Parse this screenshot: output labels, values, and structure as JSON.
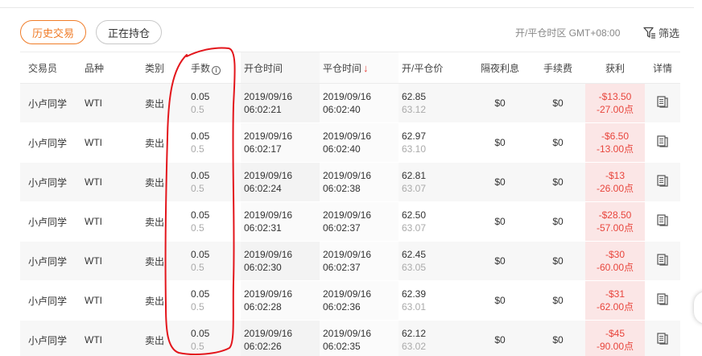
{
  "tabs": [
    {
      "label": "历史交易",
      "active": true
    },
    {
      "label": "正在持仓",
      "active": false
    }
  ],
  "timezone_label": "开/平仓时区 GMT+08:00",
  "filter_label": "筛选",
  "columns": {
    "trader": "交易员",
    "symbol": "品种",
    "type": "类别",
    "lots": "手数",
    "open_time": "开仓时间",
    "close_time": "平仓时间",
    "price": "开/平仓价",
    "swap": "隔夜利息",
    "fee": "手续费",
    "profit": "获利",
    "detail": "详情"
  },
  "sort_indicator": "↓",
  "rows": [
    {
      "trader": "小卢同学",
      "symbol": "WTI",
      "type": "卖出",
      "lots": "0.05",
      "lots_sub": "0.5",
      "open_date": "2019/09/16",
      "open_time": "06:02:21",
      "close_date": "2019/09/16",
      "close_time": "06:02:40",
      "open_price": "62.85",
      "close_price": "63.12",
      "swap": "$0",
      "fee": "$0",
      "profit": "-$13.50",
      "points": "-27.00点"
    },
    {
      "trader": "小卢同学",
      "symbol": "WTI",
      "type": "卖出",
      "lots": "0.05",
      "lots_sub": "0.5",
      "open_date": "2019/09/16",
      "open_time": "06:02:17",
      "close_date": "2019/09/16",
      "close_time": "06:02:40",
      "open_price": "62.97",
      "close_price": "63.10",
      "swap": "$0",
      "fee": "$0",
      "profit": "-$6.50",
      "points": "-13.00点"
    },
    {
      "trader": "小卢同学",
      "symbol": "WTI",
      "type": "卖出",
      "lots": "0.05",
      "lots_sub": "0.5",
      "open_date": "2019/09/16",
      "open_time": "06:02:24",
      "close_date": "2019/09/16",
      "close_time": "06:02:38",
      "open_price": "62.81",
      "close_price": "63.07",
      "swap": "$0",
      "fee": "$0",
      "profit": "-$13",
      "points": "-26.00点"
    },
    {
      "trader": "小卢同学",
      "symbol": "WTI",
      "type": "卖出",
      "lots": "0.05",
      "lots_sub": "0.5",
      "open_date": "2019/09/16",
      "open_time": "06:02:31",
      "close_date": "2019/09/16",
      "close_time": "06:02:37",
      "open_price": "62.50",
      "close_price": "63.07",
      "swap": "$0",
      "fee": "$0",
      "profit": "-$28.50",
      "points": "-57.00点"
    },
    {
      "trader": "小卢同学",
      "symbol": "WTI",
      "type": "卖出",
      "lots": "0.05",
      "lots_sub": "0.5",
      "open_date": "2019/09/16",
      "open_time": "06:02:30",
      "close_date": "2019/09/16",
      "close_time": "06:02:37",
      "open_price": "62.45",
      "close_price": "63.05",
      "swap": "$0",
      "fee": "$0",
      "profit": "-$30",
      "points": "-60.00点"
    },
    {
      "trader": "小卢同学",
      "symbol": "WTI",
      "type": "卖出",
      "lots": "0.05",
      "lots_sub": "0.5",
      "open_date": "2019/09/16",
      "open_time": "06:02:28",
      "close_date": "2019/09/16",
      "close_time": "06:02:36",
      "open_price": "62.39",
      "close_price": "63.01",
      "swap": "$0",
      "fee": "$0",
      "profit": "-$31",
      "points": "-62.00点"
    },
    {
      "trader": "小卢同学",
      "symbol": "WTI",
      "type": "卖出",
      "lots": "0.05",
      "lots_sub": "0.5",
      "open_date": "2019/09/16",
      "open_time": "06:02:26",
      "close_date": "2019/09/16",
      "close_time": "06:02:35",
      "open_price": "62.12",
      "close_price": "63.02",
      "swap": "$0",
      "fee": "$0",
      "profit": "-$45",
      "points": "-90.00点"
    }
  ],
  "colors": {
    "accent": "#f07c28",
    "loss": "#e8453c",
    "loss_bg": "#fbe6e6",
    "annotation": "#e3161c"
  },
  "icons": {
    "filter": "filter-icon",
    "info": "info-icon",
    "detail": "document-icon"
  }
}
